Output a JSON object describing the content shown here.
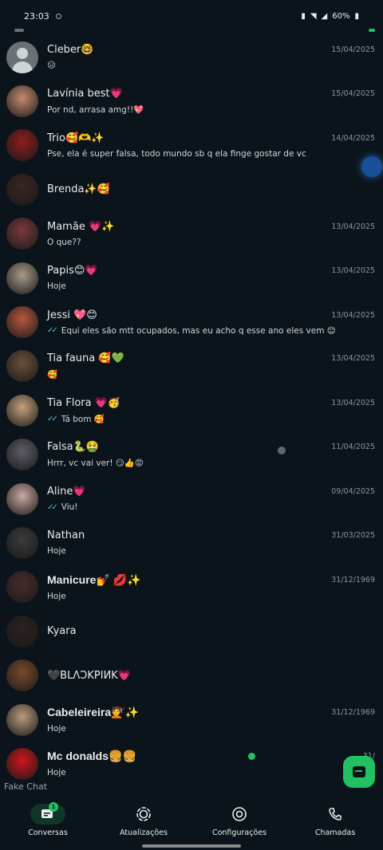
{
  "status_bar": {
    "time": "23:03",
    "battery": "60%",
    "icons": [
      "sync-icon",
      "mute-icon",
      "wifi-icon",
      "signal-icon",
      "battery-icon"
    ]
  },
  "chats": [
    {
      "name": "Cleber🤓",
      "date": "15/04/2025",
      "message": "😑",
      "ticks": false,
      "bold": false,
      "avatar": "default"
    },
    {
      "name": "Lavínia best💗",
      "date": "15/04/2025",
      "message": "Por nd, arrasa amg!!💖",
      "ticks": false,
      "bold": false,
      "avatar": "#c58a6f"
    },
    {
      "name": "Trio🥰🫶✨",
      "date": "14/04/2025",
      "message": "Pse, ela é super falsa, todo mundo sb q ela finge gostar de vc",
      "ticks": false,
      "bold": false,
      "avatar": "#8f1c1c"
    },
    {
      "name": "Brenda✨🥰",
      "date": "",
      "message": "",
      "ticks": false,
      "bold": false,
      "avatar": "#3a2624"
    },
    {
      "name": "Mamãe 💗✨",
      "date": "13/04/2025",
      "message": "O que??",
      "ticks": false,
      "bold": false,
      "avatar": "#7a3a3a"
    },
    {
      "name": "Papis😊💗",
      "date": "13/04/2025",
      "message": "Hoje",
      "ticks": false,
      "bold": false,
      "avatar": "#a89a88"
    },
    {
      "name": "Jessi 💖😊",
      "date": "13/04/2025",
      "message": "Equi eles são mtt ocupados, mas eu acho q esse ano eles vem 😊",
      "ticks": true,
      "bold": false,
      "avatar": "#b5583f"
    },
    {
      "name": "Tia fauna 🥰💚",
      "date": "13/04/2025",
      "message": "🥰",
      "ticks": false,
      "bold": false,
      "avatar": "#6b5038"
    },
    {
      "name": "Tia Flora 💗🥳",
      "date": "13/04/2025",
      "message": "Tá bom 🥰",
      "ticks": true,
      "bold": false,
      "avatar": "#c7a07a"
    },
    {
      "name": "Falsa🐍🤮",
      "date": "11/04/2025",
      "message": "Hrrr, vc vai ver! 😏👍😡",
      "ticks": false,
      "bold": false,
      "avatar": "#5d5d66"
    },
    {
      "name": "Aline💗",
      "date": "09/04/2025",
      "message": "Viu!",
      "ticks": true,
      "bold": false,
      "avatar": "#c9a8a2"
    },
    {
      "name": "Nathan",
      "date": "31/03/2025",
      "message": "Hoje",
      "ticks": false,
      "bold": false,
      "avatar": "#3c3a3a"
    },
    {
      "name": "Manicure💅 💋✨",
      "date": "31/12/1969",
      "message": "Hoje",
      "ticks": false,
      "bold": true,
      "avatar": "#4a2a2c"
    },
    {
      "name": "Kyara",
      "date": "",
      "message": "",
      "ticks": false,
      "bold": false,
      "avatar": "#2a221d"
    },
    {
      "name": "🖤BLΛƆKPIИK💗",
      "date": "",
      "message": "",
      "ticks": false,
      "bold": false,
      "avatar": "#7a4a2c"
    },
    {
      "name": "Cabeleireira💇✨",
      "date": "31/12/1969",
      "message": "Hoje",
      "ticks": false,
      "bold": true,
      "avatar": "#b89a7c"
    },
    {
      "name": "Mc donalds🍔🍔",
      "date": "31/",
      "message": "Hoje",
      "ticks": false,
      "bold": true,
      "avatar": "#d0151b",
      "online": true
    }
  ],
  "watermark": "Fake Chat",
  "fab": {
    "icon": "new-chat-icon"
  },
  "nav": {
    "items": [
      {
        "label": "Conversas",
        "icon": "chats-icon",
        "active": true,
        "badge": "1"
      },
      {
        "label": "Atualizações",
        "icon": "updates-icon",
        "active": false
      },
      {
        "label": "Configurações",
        "icon": "settings-icon",
        "active": false
      },
      {
        "label": "Chamadas",
        "icon": "phone-icon",
        "active": false
      }
    ]
  },
  "colors": {
    "background": "#0b141a",
    "accent": "#21c063",
    "read_ticks": "#53bdeb",
    "date_text": "#8696a0"
  }
}
